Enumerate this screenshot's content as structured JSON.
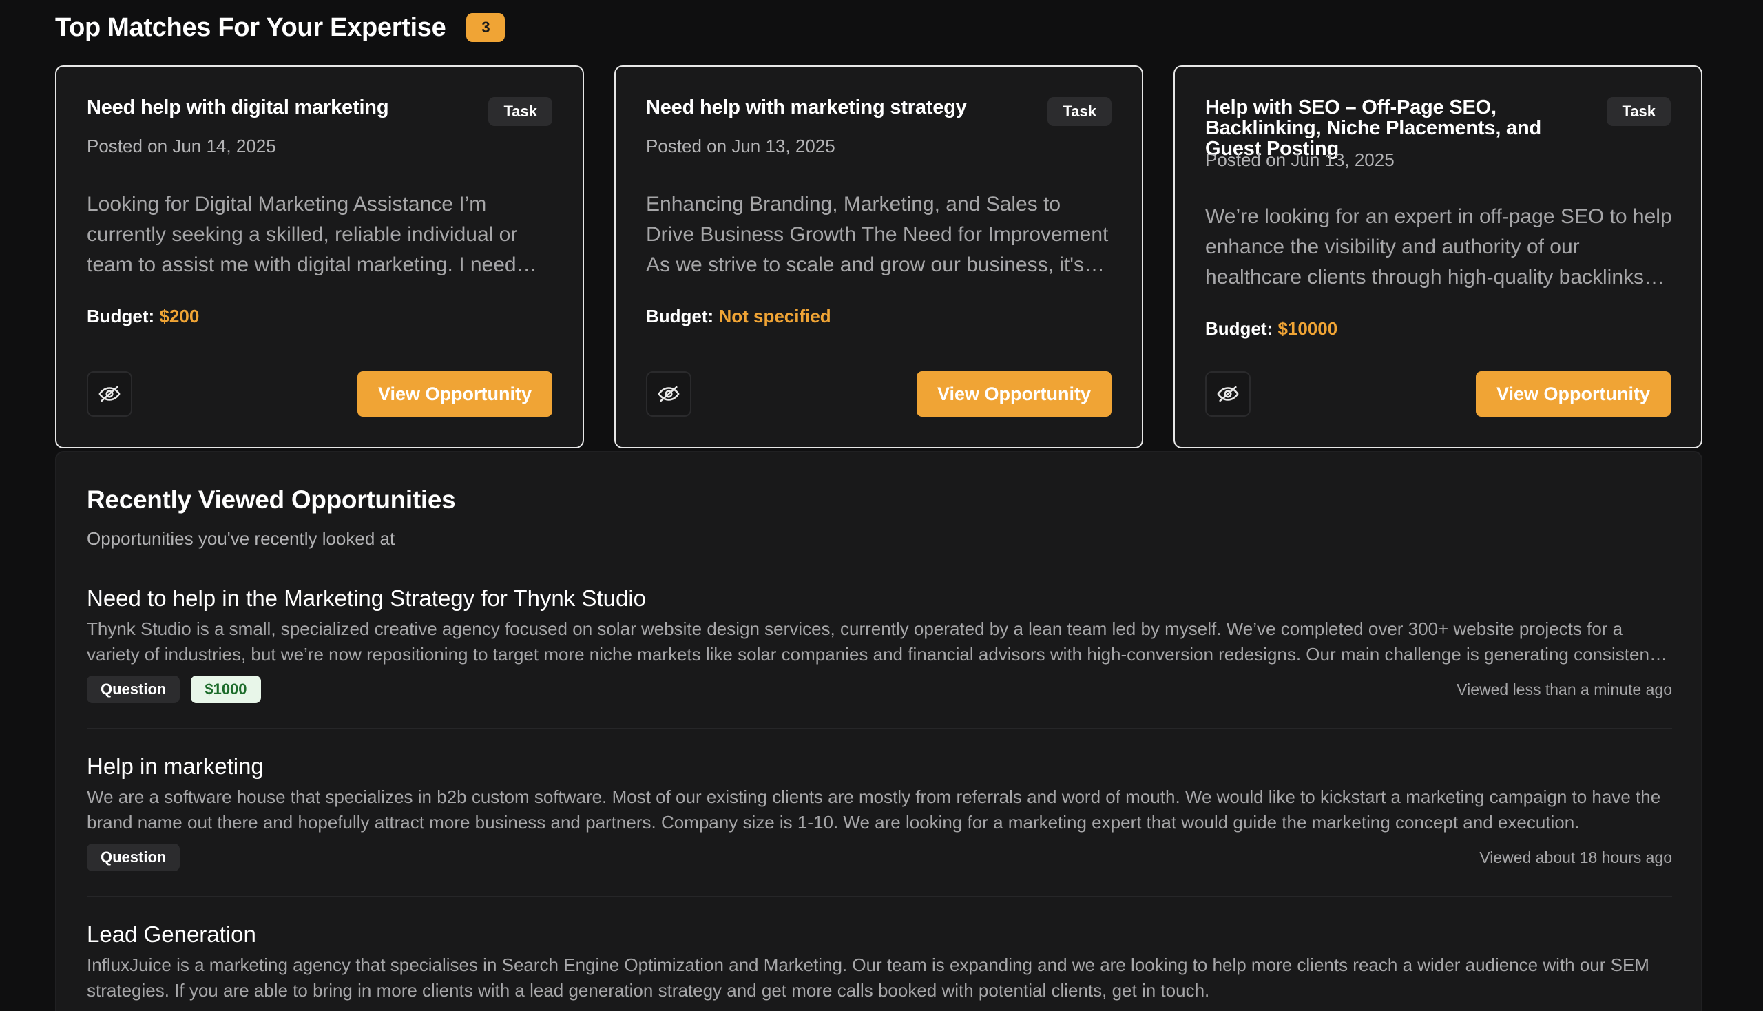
{
  "header": {
    "title": "Top Matches For Your Expertise",
    "count": "3"
  },
  "matches": [
    {
      "title": "Need help with digital marketing",
      "type": "Task",
      "posted": "Posted on Jun 14, 2025",
      "description": "Looking for Digital Marketing Assistance I’m currently seeking a skilled, reliable individual or team to assist me with digital marketing. I need ongoing support to grow my business online.",
      "budget_label": "Budget:",
      "budget_value": "$200",
      "view_label": "View Opportunity",
      "hide_icon": "eye-off-icon"
    },
    {
      "title": "Need help with marketing strategy",
      "type": "Task",
      "posted": "Posted on Jun 13, 2025",
      "description": "Enhancing Branding, Marketing, and Sales to Drive Business Growth The Need for Improvement As we strive to scale and grow our business, it's become clear that we need a stronger strategy.",
      "budget_label": "Budget:",
      "budget_value": "Not specified",
      "view_label": "View Opportunity",
      "hide_icon": "eye-off-icon"
    },
    {
      "title": "Help with SEO – Off-Page SEO, Backlinking, Niche Placements, and Guest Posting",
      "type": "Task",
      "posted": "Posted on Jun 13, 2025",
      "description": "We’re looking for an expert in off-page SEO to help enhance the visibility and authority of our healthcare clients through high-quality backlinks and niche placements.",
      "budget_label": "Budget:",
      "budget_value": "$10000",
      "view_label": "View Opportunity",
      "hide_icon": "eye-off-icon"
    }
  ],
  "recent": {
    "title": "Recently Viewed Opportunities",
    "subtitle": "Opportunities you've recently looked at",
    "items": [
      {
        "title": "Need to help in the Marketing Strategy for Thynk Studio",
        "description": "Thynk Studio is a small, specialized creative agency focused on solar website design services, currently operated by a lean team led by myself. We’ve completed over 300+ website projects for a variety of industries, but we’re now repositioning to target more niche markets like solar companies and financial advisors with high-conversion redesigns. Our main challenge is generating consistent leads.",
        "type": "Question",
        "price": "$1000",
        "viewed": "Viewed less than a minute ago"
      },
      {
        "title": "Help in marketing",
        "description": "We are a software house that specializes in b2b custom software. Most of our existing clients are mostly from referrals and word of mouth. We would like to kickstart a marketing campaign to have the brand name out there and hopefully attract more business and partners. Company size is 1-10. We are looking for a marketing expert that would guide the marketing concept and execution.",
        "type": "Question",
        "viewed": "Viewed about 18 hours ago"
      },
      {
        "title": "Lead Generation",
        "description": "InfluxJuice is a marketing agency that specialises in Search Engine Optimization and Marketing. Our team is expanding and we are looking to help more clients reach a wider audience with our SEM strategies. If you are able to bring in more clients with a lead generation strategy and get more calls booked with potential clients, get in touch."
      }
    ]
  },
  "colors": {
    "accent": "#f0a435",
    "background": "#0f0f10",
    "card": "#19191a",
    "price_badge_bg": "#e8f6e9",
    "price_badge_text": "#1c6b2a"
  }
}
